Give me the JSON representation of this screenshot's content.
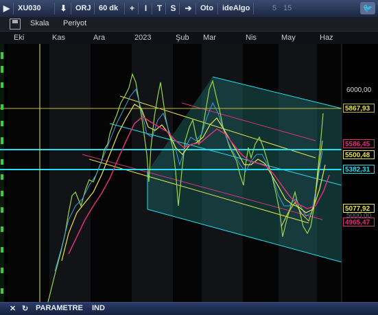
{
  "topbar": {
    "arrow_left": "▶",
    "symbol": "XU030",
    "download_icon": "⬇",
    "orj": "ORJ",
    "period": "60 dk",
    "plus": "+",
    "cursor": "I",
    "t": "T",
    "s": "S",
    "right_arrow": "➔",
    "oto": "Oto",
    "idealgo": "ideAlgo",
    "n5": "5",
    "n15": "15",
    "twitter": "🐦"
  },
  "toolbar2": {
    "scale": "Skala",
    "period": "Periyot"
  },
  "months": [
    "Eki",
    "Kas",
    "Ara",
    "2023",
    "Şub",
    "Mar",
    "Nis",
    "May",
    "Haz"
  ],
  "price_axis": {
    "p6000": "6000,00",
    "p5867": "5867,93",
    "p5586": "5586,45",
    "p5500": "5500,48",
    "p5382": "5382,31",
    "p5077": "5077,92",
    "p4965": "4965,47",
    "p5000": "5000,00"
  },
  "colors": {
    "cyan": "#22e0f0",
    "yellow": "#e8e84a",
    "magenta": "#e0307a",
    "channel": "#1f6d6b"
  },
  "bottombar": {
    "close": "✕",
    "refresh": "↻",
    "param": "PARAMETRE",
    "ind": "IND"
  }
}
